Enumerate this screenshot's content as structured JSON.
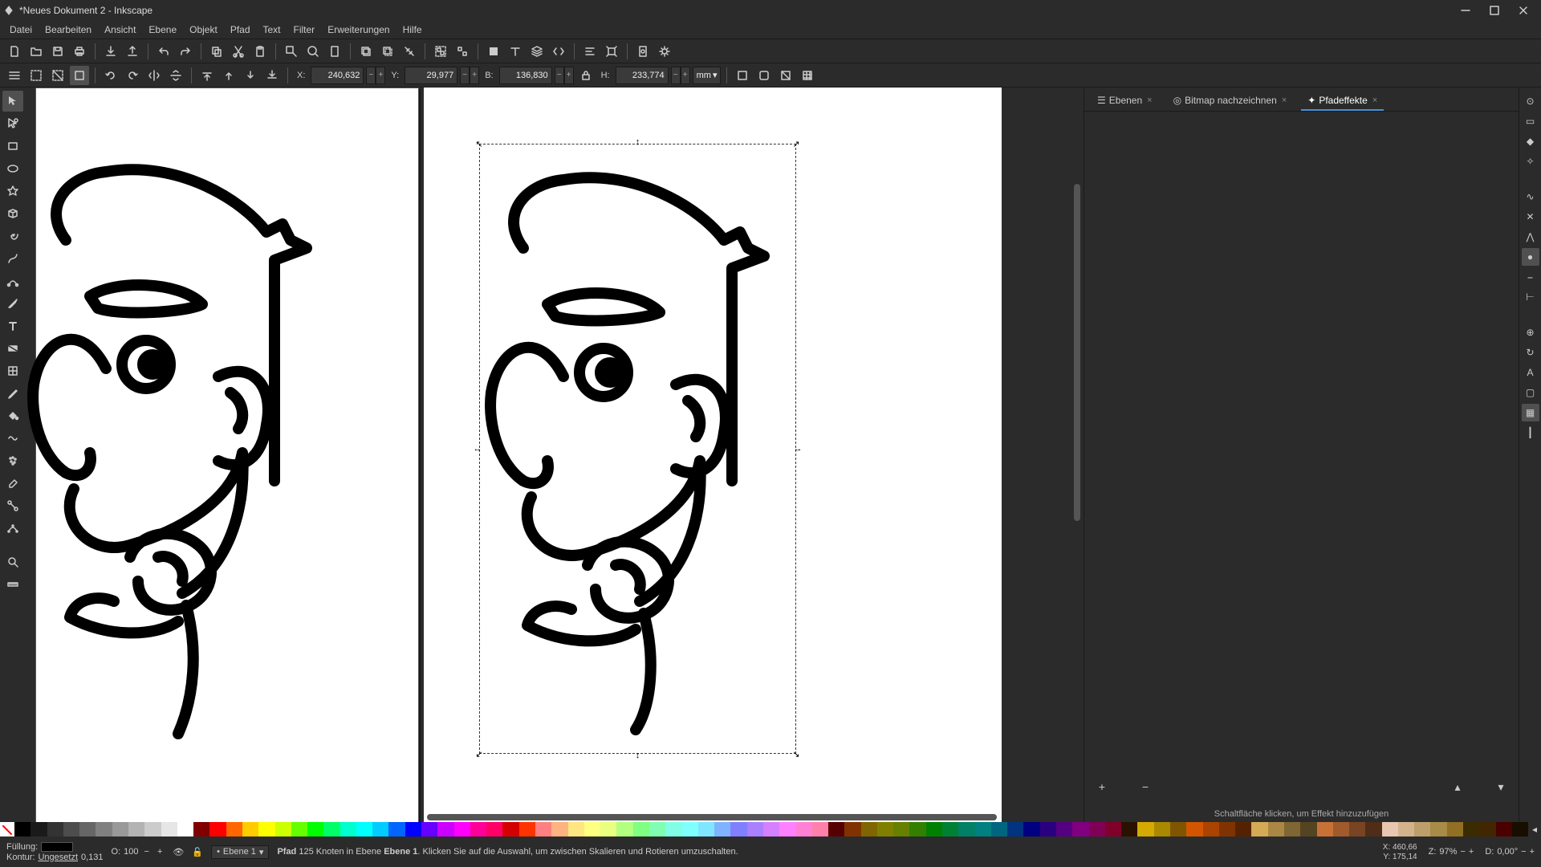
{
  "window": {
    "title": "*Neues Dokument 2 - Inkscape"
  },
  "menu": [
    "Datei",
    "Bearbeiten",
    "Ansicht",
    "Ebene",
    "Objekt",
    "Pfad",
    "Text",
    "Filter",
    "Erweiterungen",
    "Hilfe"
  ],
  "option_bar": {
    "x_label": "X:",
    "x_value": "240,632",
    "y_label": "Y:",
    "y_value": "29,977",
    "w_label": "B:",
    "w_value": "136,830",
    "h_label": "H:",
    "h_value": "233,774",
    "unit": "mm"
  },
  "side_panel": {
    "tabs": [
      {
        "label": "Ebenen"
      },
      {
        "label": "Bitmap nachzeichnen"
      },
      {
        "label": "Pfadeffekte"
      }
    ],
    "lpe_add": "+",
    "lpe_remove": "−",
    "hint": "Schaltfläche klicken, um Effekt hinzuzufügen"
  },
  "status": {
    "fill_label": "Füllung:",
    "stroke_label": "Kontur:",
    "stroke_value": "Ungesetzt",
    "stroke_width": "0,131",
    "opacity_label": "O:",
    "opacity_value": "100",
    "layer": "Ebene 1",
    "sel_type": "Pfad",
    "sel_nodes": "125",
    "sel_msg1": "Knoten in Ebene",
    "sel_layer_bold": "Ebene 1",
    "sel_msg2": ". Klicken Sie auf die Auswahl, um zwischen Skalieren und Rotieren umzuschalten.",
    "coord_x_label": "X:",
    "coord_x": "460,66",
    "coord_y_label": "Y:",
    "coord_y": "175,14",
    "zoom_label": "Z:",
    "zoom": "97%",
    "rot_label": "D:",
    "rot": "0,00°"
  },
  "palette_colors": [
    "#000000",
    "#1a1a1a",
    "#333333",
    "#4d4d4d",
    "#666666",
    "#808080",
    "#999999",
    "#b3b3b3",
    "#cccccc",
    "#e6e6e6",
    "#ffffff",
    "#800000",
    "#ff0000",
    "#ff6600",
    "#ffcc00",
    "#ffff00",
    "#ccff00",
    "#66ff00",
    "#00ff00",
    "#00ff66",
    "#00ffcc",
    "#00ffff",
    "#00ccff",
    "#0066ff",
    "#0000ff",
    "#6600ff",
    "#cc00ff",
    "#ff00ff",
    "#ff0099",
    "#ff0066",
    "#d40000",
    "#ff3300",
    "#ff8080",
    "#ffb380",
    "#ffe680",
    "#ffff80",
    "#e9ff80",
    "#b3ff80",
    "#80ff80",
    "#80ffb3",
    "#80ffe6",
    "#80ffff",
    "#80e6ff",
    "#80b3ff",
    "#8080ff",
    "#aa80ff",
    "#d580ff",
    "#ff80ff",
    "#ff80d5",
    "#ff80aa",
    "#550000",
    "#803300",
    "#806600",
    "#808000",
    "#668000",
    "#338000",
    "#008000",
    "#008033",
    "#008066",
    "#008080",
    "#006680",
    "#003380",
    "#000080",
    "#2b0080",
    "#550080",
    "#800080",
    "#800055",
    "#80002b",
    "#2b1100",
    "#d4aa00",
    "#aa8800",
    "#805500",
    "#d45500",
    "#aa4400",
    "#803300",
    "#552200",
    "#d4aa55",
    "#aa8844",
    "#806633",
    "#554422",
    "#c87137",
    "#a05a2c",
    "#784421",
    "#502d16",
    "#e9c6af",
    "#d3b38c",
    "#bd9f69",
    "#a78b46",
    "#916f23",
    "#3a2b00",
    "#422600",
    "#4b0000",
    "#170e00"
  ]
}
